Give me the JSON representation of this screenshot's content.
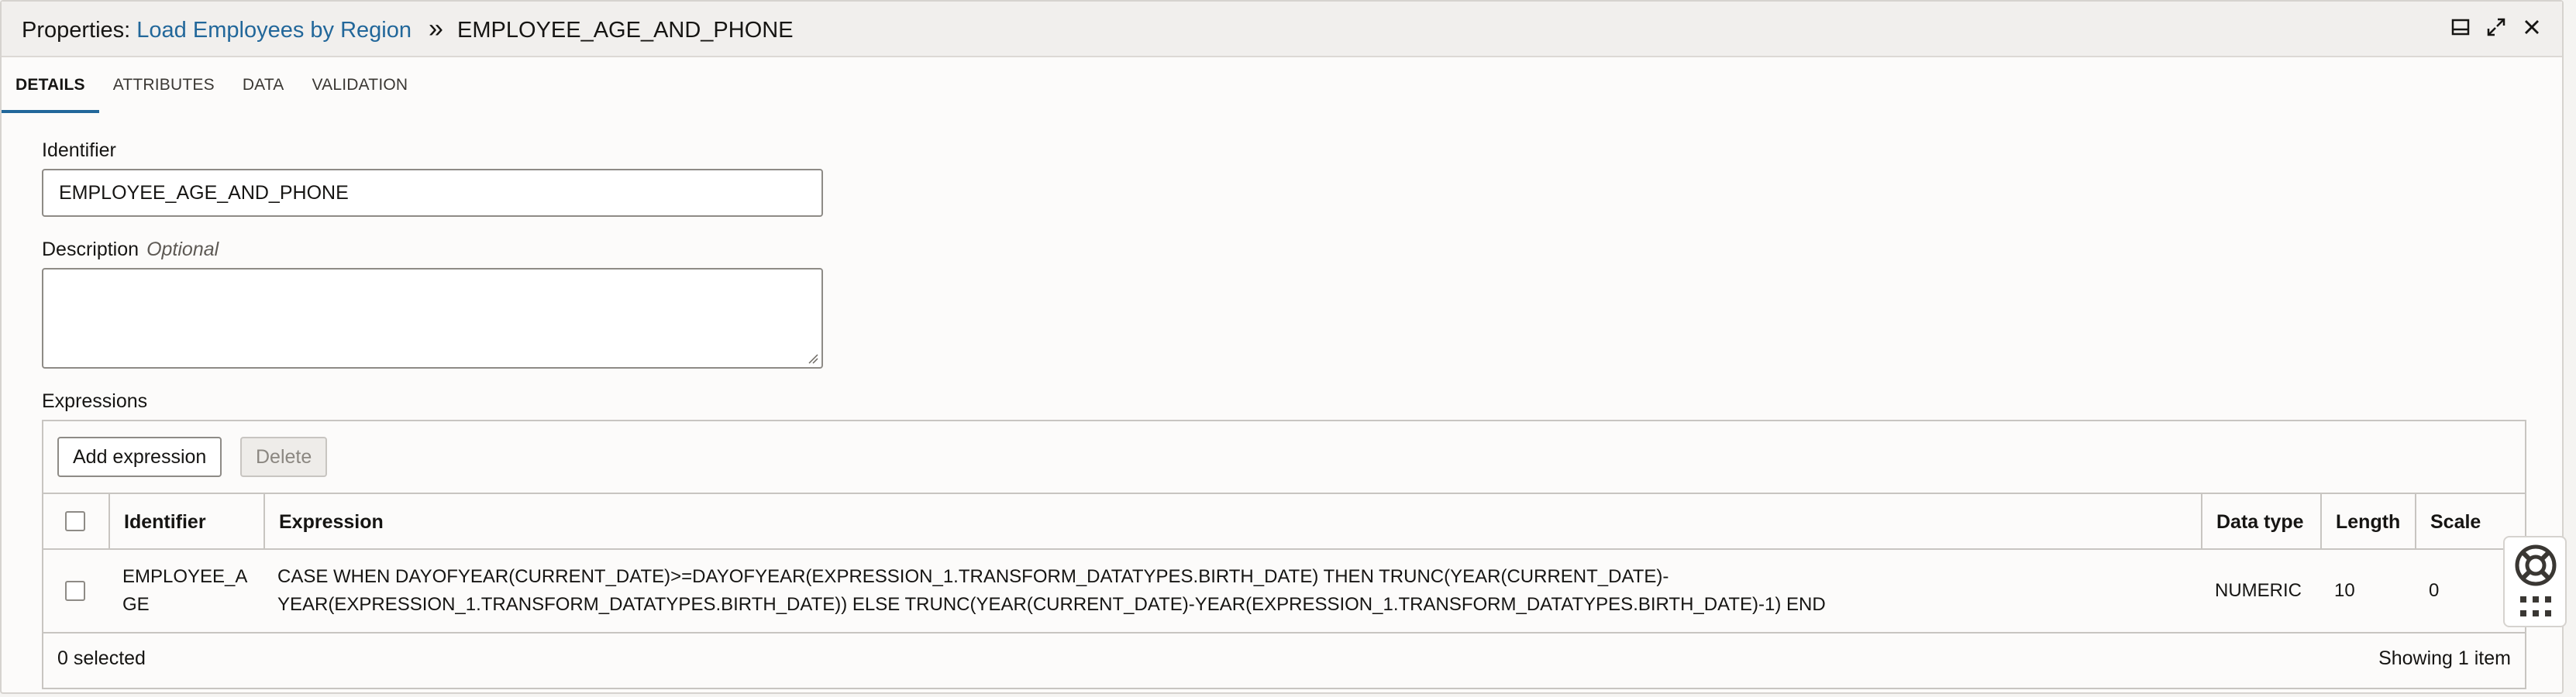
{
  "header": {
    "prefix": "Properties:",
    "link": "Load Employees by Region",
    "separator": "»",
    "current": "EMPLOYEE_AGE_AND_PHONE"
  },
  "window_icons": [
    "dock-bottom-icon",
    "expand-icon",
    "close-icon"
  ],
  "tabs": [
    {
      "label": "DETAILS",
      "active": true
    },
    {
      "label": "ATTRIBUTES",
      "active": false
    },
    {
      "label": "DATA",
      "active": false
    },
    {
      "label": "VALIDATION",
      "active": false
    }
  ],
  "identifier": {
    "label": "Identifier",
    "value": "EMPLOYEE_AGE_AND_PHONE"
  },
  "description": {
    "label": "Description",
    "hint": "Optional",
    "value": ""
  },
  "expressions": {
    "label": "Expressions",
    "add_button": "Add expression",
    "delete_button": "Delete",
    "columns": [
      "Identifier",
      "Expression",
      "Data type",
      "Length",
      "Scale"
    ],
    "rows": [
      {
        "identifier_line1": "EMPLOYEE_A",
        "identifier_line2": "GE",
        "expression_line1": "CASE WHEN DAYOFYEAR(CURRENT_DATE)>=DAYOFYEAR(EXPRESSION_1.TRANSFORM_DATATYPES.BIRTH_DATE) THEN TRUNC(YEAR(CURRENT_DATE)-",
        "expression_line2": "YEAR(EXPRESSION_1.TRANSFORM_DATATYPES.BIRTH_DATE)) ELSE TRUNC(YEAR(CURRENT_DATE)-YEAR(EXPRESSION_1.TRANSFORM_DATATYPES.BIRTH_DATE)-1) END",
        "data_type": "NUMERIC",
        "length": "10",
        "scale": "0"
      }
    ],
    "selected_text": "0 selected",
    "showing_text": "Showing 1 item"
  },
  "colors": {
    "accent": "#22679a",
    "header_bg": "#f1efed",
    "text": "#161513"
  }
}
